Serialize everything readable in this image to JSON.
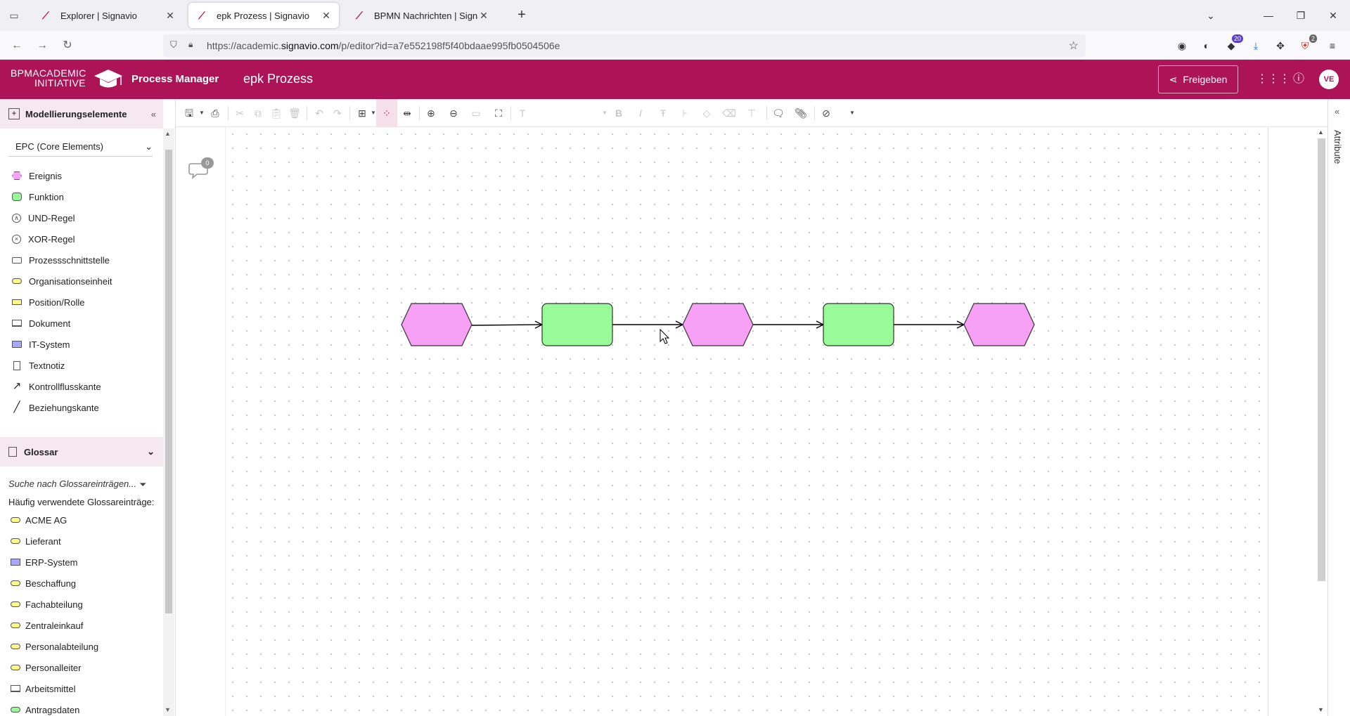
{
  "browser": {
    "tabs": [
      {
        "title": "Explorer | Signavio",
        "active": false
      },
      {
        "title": "epk Prozess | Signavio",
        "active": true
      },
      {
        "title": "BPMN Nachrichten | Signavio",
        "active": false
      }
    ],
    "url_prefix": "https://academic.",
    "url_domain": "signavio.com",
    "url_rest": "/p/editor?id=a7e552198f5f40bdaae995fb0504506e",
    "extension_badges": {
      "ext1": "20",
      "ext2": "2"
    }
  },
  "app": {
    "logo_line1": "BPMACADEMIC",
    "logo_line2": "INITIATIVE",
    "name": "Process Manager",
    "document_title": "epk Prozess",
    "share_label": "Freigeben",
    "avatar_initials": "VE",
    "brand_color": "#ad1457"
  },
  "left_panel": {
    "title": "Modellierungselemente",
    "palette_select": "EPC (Core Elements)",
    "shapes": [
      {
        "label": "Ereignis",
        "icon": "event-hexagon-icon"
      },
      {
        "label": "Funktion",
        "icon": "function-rect-icon"
      },
      {
        "label": "UND-Regel",
        "icon": "and-connector-icon"
      },
      {
        "label": "XOR-Regel",
        "icon": "xor-connector-icon"
      },
      {
        "label": "Prozessschnittstelle",
        "icon": "process-interface-icon"
      },
      {
        "label": "Organisationseinheit",
        "icon": "org-unit-icon"
      },
      {
        "label": "Position/Rolle",
        "icon": "position-role-icon"
      },
      {
        "label": "Dokument",
        "icon": "document-icon"
      },
      {
        "label": "IT-System",
        "icon": "it-system-icon"
      },
      {
        "label": "Textnotiz",
        "icon": "text-note-icon"
      },
      {
        "label": "Kontrollflusskante",
        "icon": "control-flow-icon"
      },
      {
        "label": "Beziehungskante",
        "icon": "relation-edge-icon"
      }
    ],
    "glossary": {
      "title": "Glossar",
      "search_placeholder": "Suche nach Glossareinträgen...",
      "frequent_label": "Häufig verwendete Glossareinträge:",
      "items": [
        {
          "label": "ACME AG",
          "type": "org"
        },
        {
          "label": "Lieferant",
          "type": "org"
        },
        {
          "label": "ERP-System",
          "type": "it"
        },
        {
          "label": "Beschaffung",
          "type": "org"
        },
        {
          "label": "Fachabteilung",
          "type": "org"
        },
        {
          "label": "Zentraleinkauf",
          "type": "org"
        },
        {
          "label": "Personalabteilung",
          "type": "org"
        },
        {
          "label": "Personalleiter",
          "type": "org"
        },
        {
          "label": "Arbeitsmittel",
          "type": "doc"
        },
        {
          "label": "Antragsdaten",
          "type": "func"
        }
      ]
    }
  },
  "canvas": {
    "comment_count": "0",
    "event_color": "#f6a0f6",
    "function_color": "#98fb98",
    "nodes": [
      {
        "kind": "event"
      },
      {
        "kind": "function"
      },
      {
        "kind": "event"
      },
      {
        "kind": "function"
      },
      {
        "kind": "event"
      }
    ]
  },
  "right_panel": {
    "label": "Attribute"
  }
}
